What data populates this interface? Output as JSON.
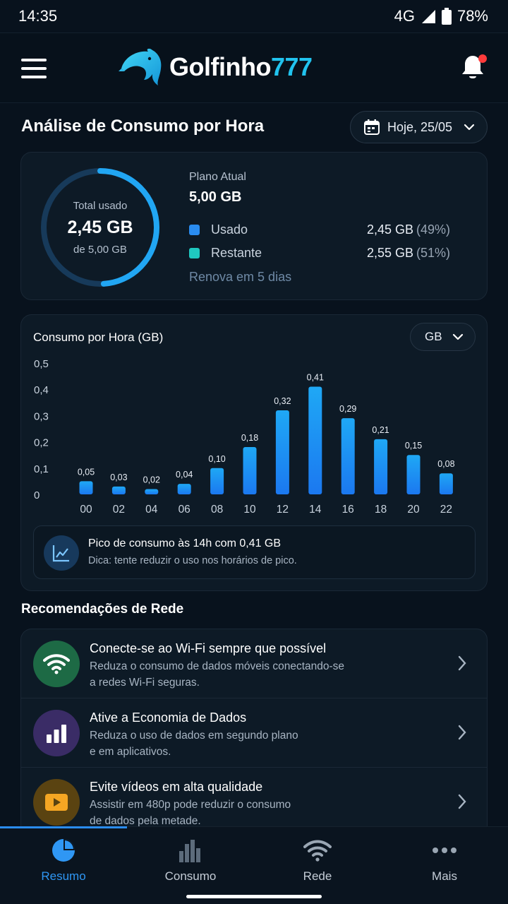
{
  "status_bar": {
    "time": "14:35",
    "network": "4G",
    "battery": "78%"
  },
  "header": {
    "brand_name": "Golfinho",
    "brand_number": "777",
    "notification_dot": true
  },
  "page": {
    "title": "Análise de Consumo por Hora",
    "date_selector": "Hoje, 25/05"
  },
  "summary": {
    "donut_label": "Total usado",
    "donut_value": "2,45 GB",
    "donut_sub": "de 5,00 GB",
    "used_fraction": 0.49,
    "plan_label": "Plano Atual",
    "plan_value": "5,00 GB",
    "legend": [
      {
        "name": "Usado",
        "value": "2,45 GB",
        "percent": "(49%)",
        "color": "#2a8cf0"
      },
      {
        "name": "Restante",
        "value": "2,55 GB",
        "percent": "(51%)",
        "color": "#1fc8c0"
      }
    ],
    "renew_text": "Renova em 5 dias"
  },
  "hourly_chart": {
    "title": "Consumo por Hora (GB)",
    "unit_selector": "GB",
    "insight_title": "Pico de consumo às 14h com 0,41 GB",
    "insight_tip": "Dica: tente reduzir o uso nos horários de pico."
  },
  "chart_data": {
    "type": "bar",
    "title": "Consumo por Hora (GB)",
    "xlabel": "",
    "ylabel": "",
    "categories": [
      "00",
      "02",
      "04",
      "06",
      "08",
      "10",
      "12",
      "14",
      "16",
      "18",
      "20",
      "22"
    ],
    "values": [
      0.05,
      0.03,
      0.02,
      0.04,
      0.1,
      0.18,
      0.32,
      0.41,
      0.29,
      0.21,
      0.15,
      0.08
    ],
    "value_labels": [
      "0,05",
      "0,03",
      "0,02",
      "0,04",
      "0,10",
      "0,18",
      "0,32",
      "0,41",
      "0,29",
      "0,21",
      "0,15",
      "0,08"
    ],
    "yticks": [
      "0",
      "0,1",
      "0,2",
      "0,3",
      "0,4",
      "0,5"
    ],
    "ylim": [
      0,
      0.5
    ],
    "grid": false,
    "bar_color": "#2a8cf0"
  },
  "recommendations": {
    "title": "Recomendações de Rede",
    "items": [
      {
        "title": "Conecte-se ao Wi-Fi sempre que possível",
        "line1": "Reduza o consumo de dados móveis conectando-se",
        "line2": "a redes Wi-Fi seguras.",
        "icon": "wifi-icon",
        "color": "#1d6a45"
      },
      {
        "title": "Ative a Economia de Dados",
        "line1": "Reduza o uso de dados em segundo plano",
        "line2": "e em aplicativos.",
        "icon": "bar-chart-icon",
        "color": "#3a2c66"
      },
      {
        "title": "Evite vídeos em alta qualidade",
        "line1": "Assistir em 480p pode reduzir o consumo",
        "line2": "de dados pela metade.",
        "icon": "video-icon",
        "color": "#5a4311"
      }
    ]
  },
  "bottom_nav": {
    "items": [
      {
        "label": "Resumo",
        "icon": "pie-chart-icon",
        "active": true
      },
      {
        "label": "Consumo",
        "icon": "bar-chart-icon",
        "active": false
      },
      {
        "label": "Rede",
        "icon": "wifi-icon",
        "active": false
      },
      {
        "label": "Mais",
        "icon": "more-icon",
        "active": false
      }
    ]
  }
}
